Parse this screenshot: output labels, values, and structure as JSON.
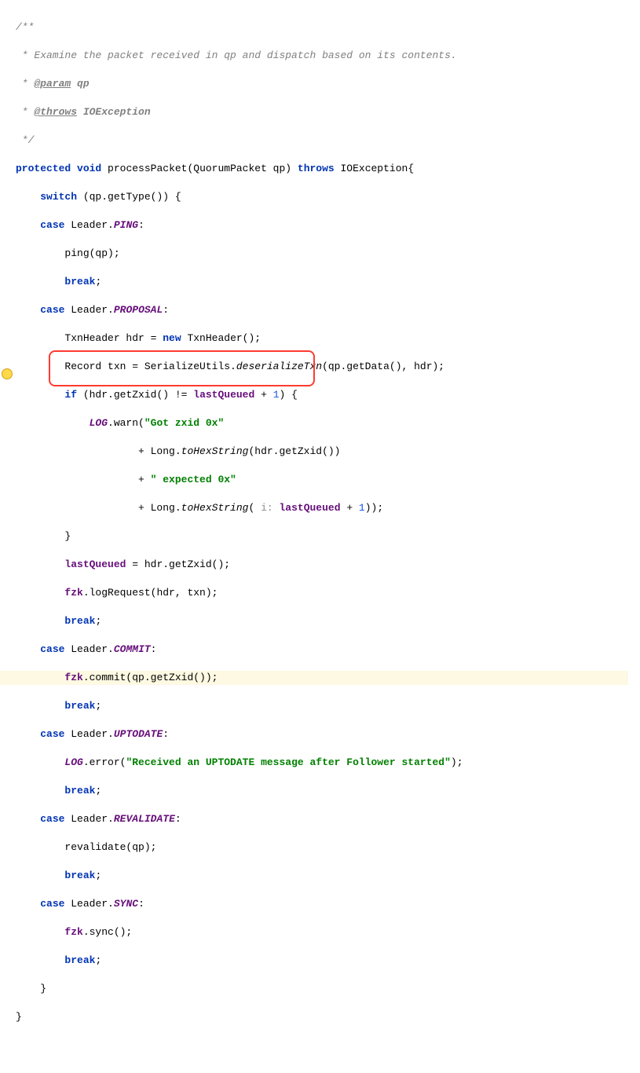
{
  "code": {
    "c1": "/**",
    "c2": " * Examine the packet received in qp and dispatch based on its contents.",
    "c3": " * ",
    "c3tag": "@param",
    "c3var": " qp",
    "c4": " * ",
    "c4tag": "@throws",
    "c4ex": " IOException",
    "c5": " */",
    "sig": {
      "protected": "protected",
      "void": "void",
      "name": " processPacket(QuorumPacket qp) ",
      "throws": "throws",
      "ex": " IOException{"
    },
    "sw": {
      "switch": "switch",
      "expr": " (qp.getType()) {"
    },
    "cases": {
      "case": "case",
      "leader": " Leader."
    },
    "ping": {
      "label": "PING",
      "call": "ping(qp);"
    },
    "proposal": {
      "label": "PROPOSAL",
      "l1a": "TxnHeader hdr = ",
      "new": "new",
      "l1b": " TxnHeader();",
      "l2a": "Record txn = SerializeUtils.",
      "l2m": "deserializeTxn",
      "l2b": "(qp.getData(), hdr);",
      "if": "if",
      "ifc": " (hdr.getZxid() != ",
      "lastQueued": "lastQueued",
      "plus1": " + ",
      "one": "1",
      "ifend": ") {",
      "log": "LOG",
      "warn": ".warn(",
      "s1": "\"Got zxid 0x\"",
      "plus": "+ Long.",
      "toHex": "toHexString",
      "arg1": "(hdr.getZxid())",
      "s2": "\" expected 0x\"",
      "hint": " i: ",
      "arg2end": "));",
      "assign": " = hdr.getZxid();",
      "fzk": "fzk",
      "logreq": ".logRequest(hdr, txn);"
    },
    "commit": {
      "label": "COMMIT",
      "call": ".commit(qp.getZxid());"
    },
    "uptodate": {
      "label": "UPTODATE",
      "err": ".error(",
      "msg": "\"Received an UPTODATE message after Follower started\"",
      "end": ");"
    },
    "revalidate": {
      "label": "REVALIDATE",
      "call": "revalidate(qp);"
    },
    "sync": {
      "label": "SYNC",
      "call": ".sync();"
    },
    "break": "break",
    "semi": ";",
    "colon": ":",
    "cbrace": "}",
    "plus": " + "
  }
}
